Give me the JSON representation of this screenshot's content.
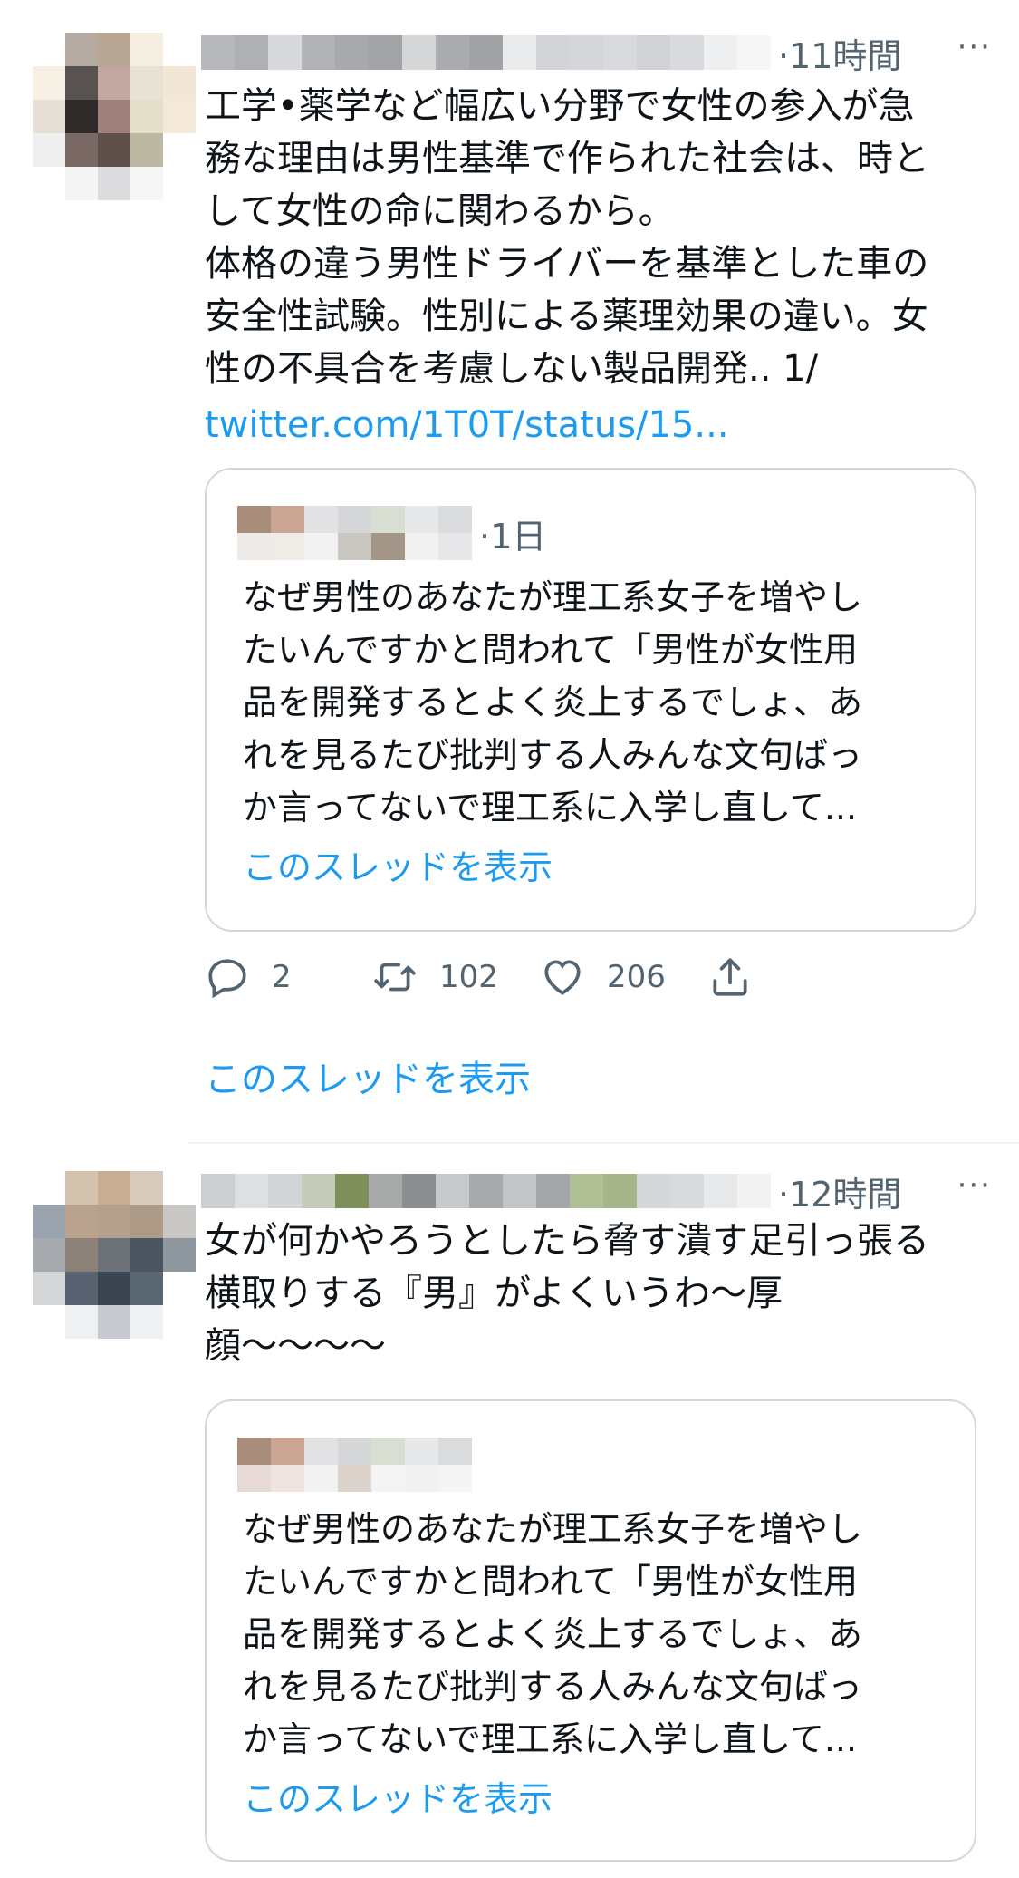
{
  "tweets": [
    {
      "time": "·11時間",
      "more": "···",
      "text": "工学•薬学など幅広い分野で女性の参入が急\n務な理由は男性基準で作られた社会は、時と\nして女性の命に関わるから。\n体格の違う男性ドライバーを基準とした車の\n安全性試験。性別による薬理効果の違い。女\n性の不具合を考慮しない製品開発.. 1/",
      "link": "twitter.com/1T0T/status/15...",
      "quote": {
        "time": "·1日",
        "text": "なぜ男性のあなたが理工系女子を増やし\nたいんですかと問われて「男性が女性用\n品を開発するとよく炎上するでしょ、あ\nれを見るたび批判する人みんな文句ばっ\nか言ってないで理工系に入学し直して...",
        "thread": "このスレッドを表示"
      },
      "actions": {
        "reply_count": "2",
        "retweet_count": "102",
        "like_count": "206"
      },
      "thread": "このスレッドを表示"
    },
    {
      "time": "·12時間",
      "more": "···",
      "text": "女が何かやろうとしたら脅す潰す足引っ張る\n横取りする『男』がよくいうわ〜厚\n顔〜〜〜〜",
      "quote": {
        "time": "",
        "text": "なぜ男性のあなたが理工系女子を増やし\nたいんですかと問われて「男性が女性用\n品を開発するとよく炎上するでしょ、あ\nれを見るたび批判する人みんな文句ばっ\nか言ってないで理工系に入学し直して...",
        "thread": "このスレッドを表示"
      }
    }
  ],
  "colors": {
    "link": "#1d9bf0",
    "muted": "#536471",
    "border": "#cfd9de"
  },
  "icons": [
    "reply-icon",
    "retweet-icon",
    "like-icon",
    "share-icon",
    "more-icon"
  ]
}
